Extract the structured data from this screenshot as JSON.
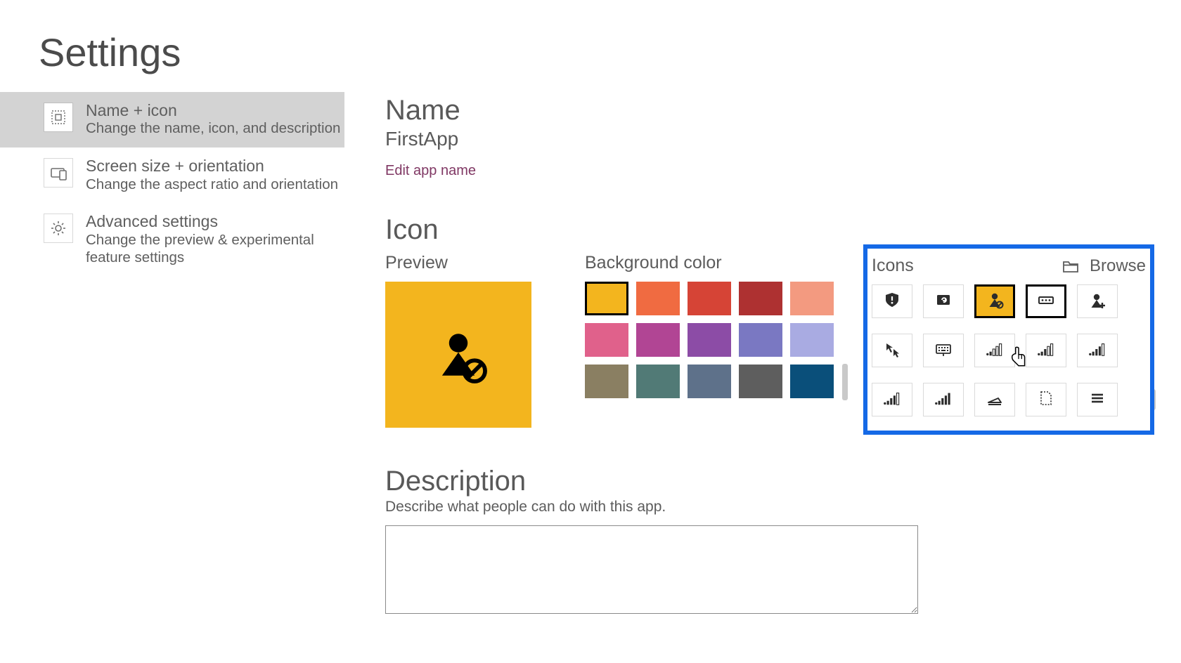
{
  "page_title": "Settings",
  "sidebar": {
    "items": [
      {
        "title": "Name + icon",
        "sub": "Change the name, icon, and description",
        "icon": "grid-dashed-icon",
        "active": true
      },
      {
        "title": "Screen size + orientation",
        "sub": "Change the aspect ratio and orientation",
        "icon": "device-icon",
        "active": false
      },
      {
        "title": "Advanced settings",
        "sub": "Change the preview & experimental feature settings",
        "icon": "gear-icon",
        "active": false
      }
    ]
  },
  "name": {
    "heading": "Name",
    "value": "FirstApp",
    "edit_link": "Edit app name"
  },
  "icon": {
    "heading": "Icon",
    "preview_label": "Preview",
    "preview_bg": "#f3b51e",
    "preview_icon": "user-block-icon",
    "bg_label": "Background color",
    "bg_colors": [
      [
        "#f3b51e",
        true
      ],
      [
        "#f06b41",
        false
      ],
      [
        "#d64436",
        false
      ],
      [
        "#ae3131",
        false
      ],
      [
        "#f39a80",
        false
      ],
      [
        "#e0618b",
        false
      ],
      [
        "#b14594",
        false
      ],
      [
        "#8c4ca6",
        false
      ],
      [
        "#7a78c2",
        false
      ],
      [
        "#a9abe2",
        false
      ],
      [
        "#8a7f62",
        false
      ],
      [
        "#517a76",
        false
      ],
      [
        "#5e718a",
        false
      ],
      [
        "#5e5e5e",
        false
      ],
      [
        "#0a4f7a",
        false
      ]
    ],
    "icons_label": "Icons",
    "browse_label": "Browse",
    "icons": [
      {
        "name": "shield-alert-icon",
        "state": ""
      },
      {
        "name": "image-refresh-icon",
        "state": ""
      },
      {
        "name": "user-block-icon",
        "state": "selected"
      },
      {
        "name": "password-field-icon",
        "state": "inspected"
      },
      {
        "name": "user-add-icon",
        "state": ""
      },
      {
        "name": "pointer-click-icon",
        "state": ""
      },
      {
        "name": "keyboard-icon",
        "state": ""
      },
      {
        "name": "bars-0-icon",
        "state": ""
      },
      {
        "name": "bars-1-icon",
        "state": ""
      },
      {
        "name": "bars-2-icon",
        "state": ""
      },
      {
        "name": "bars-3-icon",
        "state": ""
      },
      {
        "name": "bars-4-icon",
        "state": ""
      },
      {
        "name": "scanner-icon",
        "state": ""
      },
      {
        "name": "page-dashed-icon",
        "state": ""
      },
      {
        "name": "menu-lines-icon",
        "state": ""
      }
    ]
  },
  "description": {
    "heading": "Description",
    "hint": "Describe what people can do with this app.",
    "value": ""
  }
}
